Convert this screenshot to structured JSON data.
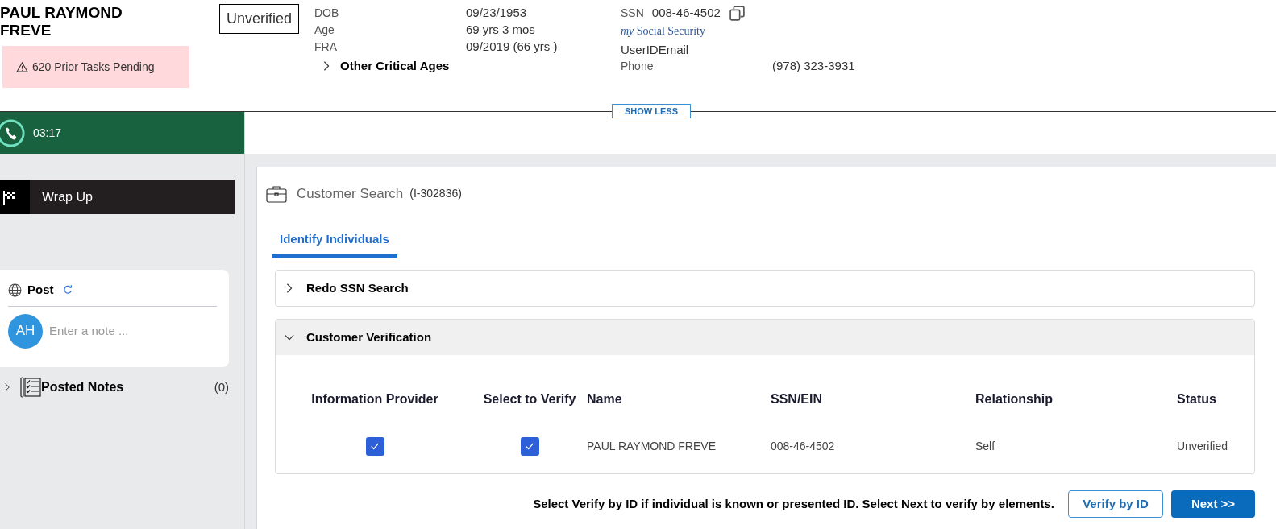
{
  "header": {
    "customer_name": "PAUL RAYMOND FREVE",
    "alert": "620 Prior Tasks Pending",
    "verification_badge": "Unverified",
    "dates": [
      {
        "label": "DOB",
        "value": "09/23/1953"
      },
      {
        "label": "Age",
        "value": "69 yrs 3 mos"
      },
      {
        "label": "FRA",
        "value": "09/2019 (66 yrs )"
      }
    ],
    "other_critical_ages": {
      "label": "Other Critical Ages",
      "expanded": false
    },
    "ssn": {
      "label": "SSN",
      "value": "008-46-4502"
    },
    "my_social_security": "*my* Social Security",
    "user_id_email": "UserIDEmail",
    "phone": {
      "label": "Phone",
      "value": "(978) 323-3931"
    },
    "toggle": "SHOW LESS"
  },
  "call": {
    "timer": "03:17"
  },
  "sidebar": {
    "wrap_up": "Wrap Up",
    "post": {
      "title": "Post",
      "avatar": "AH",
      "placeholder": "Enter a note ..."
    },
    "posted_notes": {
      "label": "Posted Notes",
      "count": "(0)",
      "expanded": false
    }
  },
  "main": {
    "title": "Customer Search",
    "case_id": "(I-302836)",
    "tabs": [
      {
        "label": "Identify Individuals",
        "selected": true
      }
    ],
    "sections": [
      {
        "title": "Redo SSN Search",
        "expanded": false
      },
      {
        "title": "Customer Verification",
        "expanded": true
      }
    ],
    "table": {
      "columns": [
        "Information Provider",
        "Select to Verify",
        "Name",
        "SSN/EIN",
        "Relationship",
        "Status"
      ],
      "rows": [
        {
          "information_provider": true,
          "select_to_verify": true,
          "name": "PAUL RAYMOND FREVE",
          "ssn": "008-46-4502",
          "relationship": "Self",
          "status": "Unverified"
        }
      ]
    },
    "instruction": "Select Verify by ID if individual is known or presented ID. Select Next to verify by elements.",
    "buttons": [
      {
        "label": "Verify by ID",
        "kind": "secondary"
      },
      {
        "label": "Next >>",
        "kind": "primary"
      }
    ]
  }
}
